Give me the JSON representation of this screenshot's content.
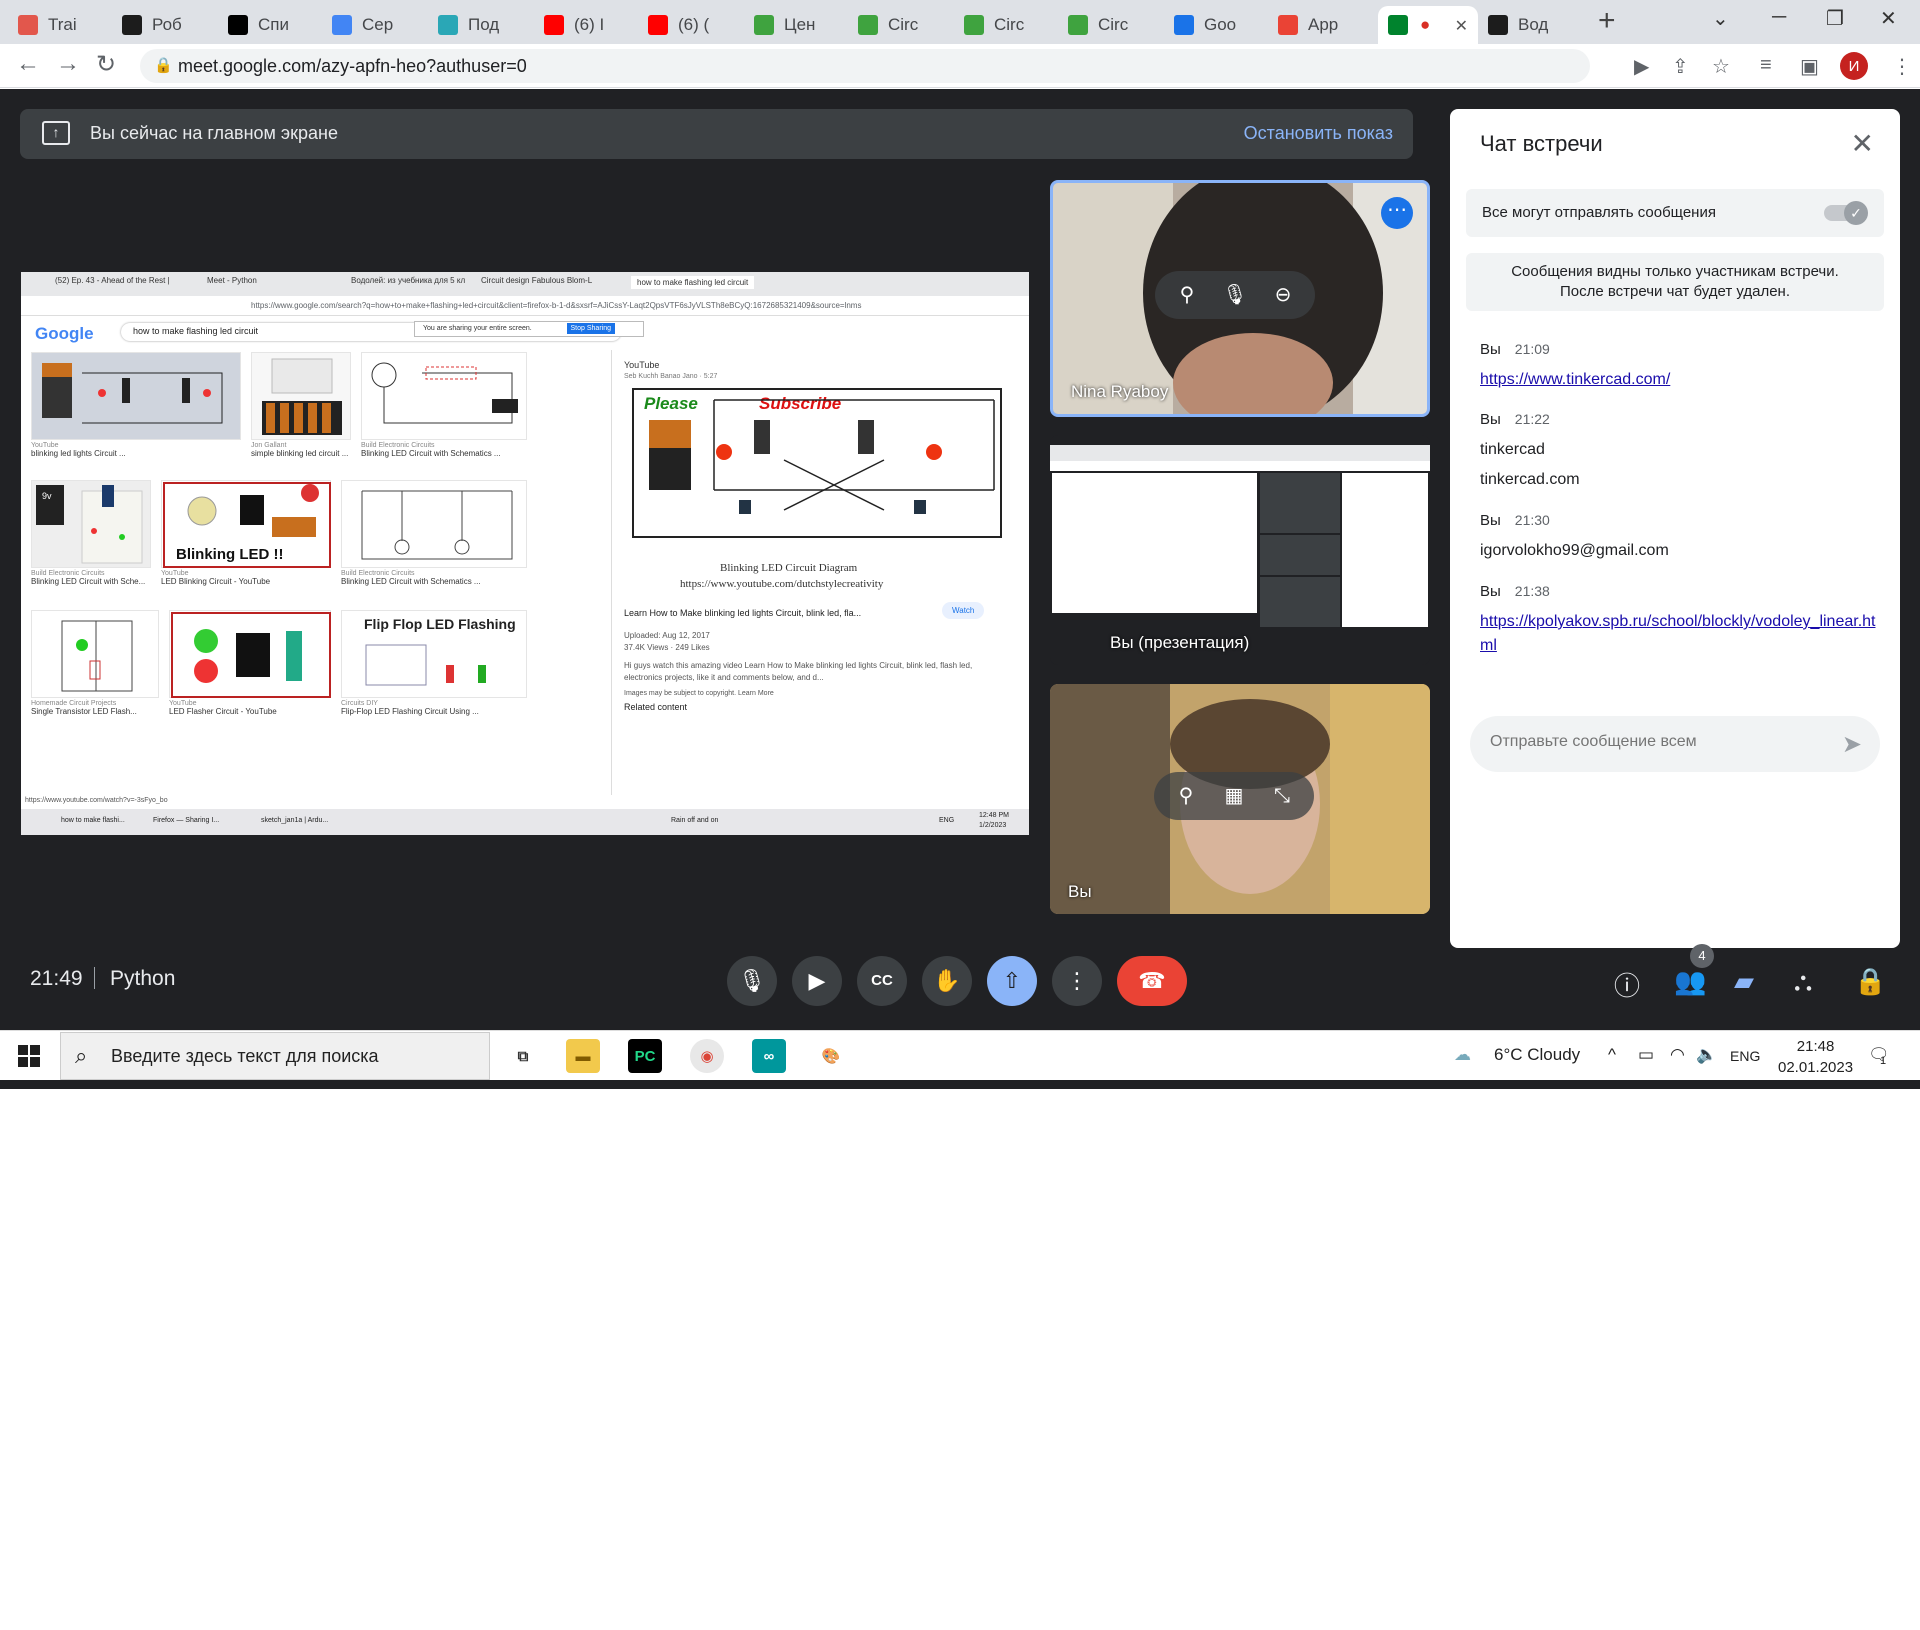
{
  "browser": {
    "tabs": [
      {
        "label": "Trai",
        "icon": "app-icon",
        "color": "#e2574c"
      },
      {
        "label": "Роб",
        "icon": "k-icon",
        "color": "#1c1c1c"
      },
      {
        "label": "Спи",
        "icon": "wikipedia-icon",
        "color": "#000000"
      },
      {
        "label": "Сер",
        "icon": "google-icon",
        "color": "#4285f4"
      },
      {
        "label": "Под",
        "icon": "gear-icon",
        "color": "#2aa7b6"
      },
      {
        "label": "(6) I",
        "icon": "youtube-icon",
        "color": "#ff0000"
      },
      {
        "label": "(6) (",
        "icon": "youtube-icon",
        "color": "#ff0000"
      },
      {
        "label": "Цен",
        "icon": "tinkercad-icon",
        "color": "#3fa33f"
      },
      {
        "label": "Circ",
        "icon": "tinkercad-icon",
        "color": "#3fa33f"
      },
      {
        "label": "Circ",
        "icon": "tinkercad-icon",
        "color": "#3fa33f"
      },
      {
        "label": "Circ",
        "icon": "tinkercad-icon",
        "color": "#3fa33f"
      },
      {
        "label": "Goo",
        "icon": "calendar-icon",
        "color": "#1a73e8"
      },
      {
        "label": "App",
        "icon": "gmail-icon",
        "color": "#ea4335"
      },
      {
        "label": "",
        "icon": "meet-icon",
        "color": "#00832d"
      },
      {
        "label": "Вод",
        "icon": "k-icon",
        "color": "#1c1c1c"
      }
    ],
    "url": "meet.google.com/azy-apfn-heo?authuser=0",
    "profile_initial": "И"
  },
  "banner": {
    "text": "Вы сейчас на главном экране",
    "stop": "Остановить показ"
  },
  "presentation": {
    "tabs": [
      "(52) Ep. 43 - Ahead of the Rest |",
      "Meet - Python",
      "Водолей: из учебника для 5 кл",
      "Circuit design Fabulous Blom-L",
      "how to make flashing led circuit"
    ],
    "url": "https://www.google.com/search?q=how+to+make+flashing+led+circuit&client=firefox-b-1-d&sxsrf=AJiCssY-Laqt2QpsVTF6sJyVLSTh8eBCyQ:1672685321409&source=lnms",
    "logo": "Google",
    "query": "how to make flashing led circuit",
    "share_notice": "You are sharing your entire screen.",
    "share_stop": "Stop Sharing",
    "results": [
      {
        "source": "YouTube",
        "title": "blinking led lights Circuit ..."
      },
      {
        "source": "Jon Gallant",
        "title": "simple blinking led circuit ..."
      },
      {
        "source": "Build Electronic Circuits",
        "title": "Blinking LED Circuit with Schematics ..."
      },
      {
        "source": "Build Electronic Circuits",
        "title": "Blinking LED Circuit with Sche..."
      },
      {
        "source": "YouTube",
        "title": "LED Blinking Circuit - YouTube"
      },
      {
        "source": "Build Electronic Circuits",
        "title": "Blinking LED Circuit with Schematics ..."
      },
      {
        "source": "Homemade Circuit Projects",
        "title": "Single Transistor LED Flash..."
      },
      {
        "source": "YouTube",
        "title": "LED Flasher Circuit - YouTube"
      },
      {
        "source": "Circuits DIY",
        "title": "Flip-Flop LED Flashing Circuit Using ..."
      }
    ],
    "thumb_texts": {
      "blinking": "Blinking LED !!",
      "flipflop": "Flip Flop LED Flashing",
      "battery": "9v"
    },
    "panel": {
      "source": "YouTube",
      "channel": "Seb Kuchh Banao Jano · 5:27",
      "diagram_left": "Please",
      "diagram_right": "Subscribe",
      "caption1": "Blinking LED Circuit Diagram",
      "caption2": "https://www.youtube.com/dutchstylecreativity",
      "title": "Learn How to Make blinking led lights Circuit, blink led, fla...",
      "watch": "Watch",
      "uploaded": "Uploaded: Aug 12, 2017",
      "views": "37.4K Views · 249 Likes",
      "description": "Hi guys watch this amazing video Learn How to Make blinking led lights Circuit, blink led, flash led, electronics projects, like it and comments below, and d...",
      "copyright": "Images may be subject to copyright. Learn More",
      "related": "Related content"
    },
    "status": "https://www.youtube.com/watch?v=-3sFyo_bo",
    "taskbar": [
      "how to make flashi...",
      "Firefox — Sharing I...",
      "sketch_jan1a | Ardu..."
    ],
    "weather": "Rain off and on",
    "lang": "ENG",
    "time": "12:48 PM",
    "date": "1/2/2023"
  },
  "tiles": [
    {
      "name": "Nina Ryaboy"
    },
    {
      "name": "Вы (презентация)"
    },
    {
      "name": "Вы"
    }
  ],
  "chat": {
    "title": "Чат встречи",
    "toggle_label": "Все могут отправлять сообщения",
    "toggle_on": true,
    "notice_line1": "Сообщения видны только участникам встречи.",
    "notice_line2": "После встречи чат будет удален.",
    "messages": [
      {
        "sender": "Вы",
        "time": "21:09",
        "lines": [
          "https://www.tinkercad.com/"
        ],
        "link": true
      },
      {
        "sender": "Вы",
        "time": "21:22",
        "lines": [
          "tinkercad",
          "tinkercad.com"
        ],
        "link": false
      },
      {
        "sender": "Вы",
        "time": "21:30",
        "lines": [
          "igorvolokho99@gmail.com"
        ],
        "link": false
      },
      {
        "sender": "Вы",
        "time": "21:38",
        "lines": [
          "https://kpolyakov.spb.ru/school/blockly/vodoley_linear.html"
        ],
        "link": true
      }
    ],
    "input_placeholder": "Отправьте сообщение всем"
  },
  "controls": {
    "time": "21:49",
    "meeting_name": "Python",
    "participants_count": "4"
  },
  "taskbar": {
    "search_placeholder": "Введите здесь текст для поиска",
    "weather": "6°C  Cloudy",
    "lang": "ENG",
    "time": "21:48",
    "date": "02.01.2023",
    "notifications": "1"
  }
}
